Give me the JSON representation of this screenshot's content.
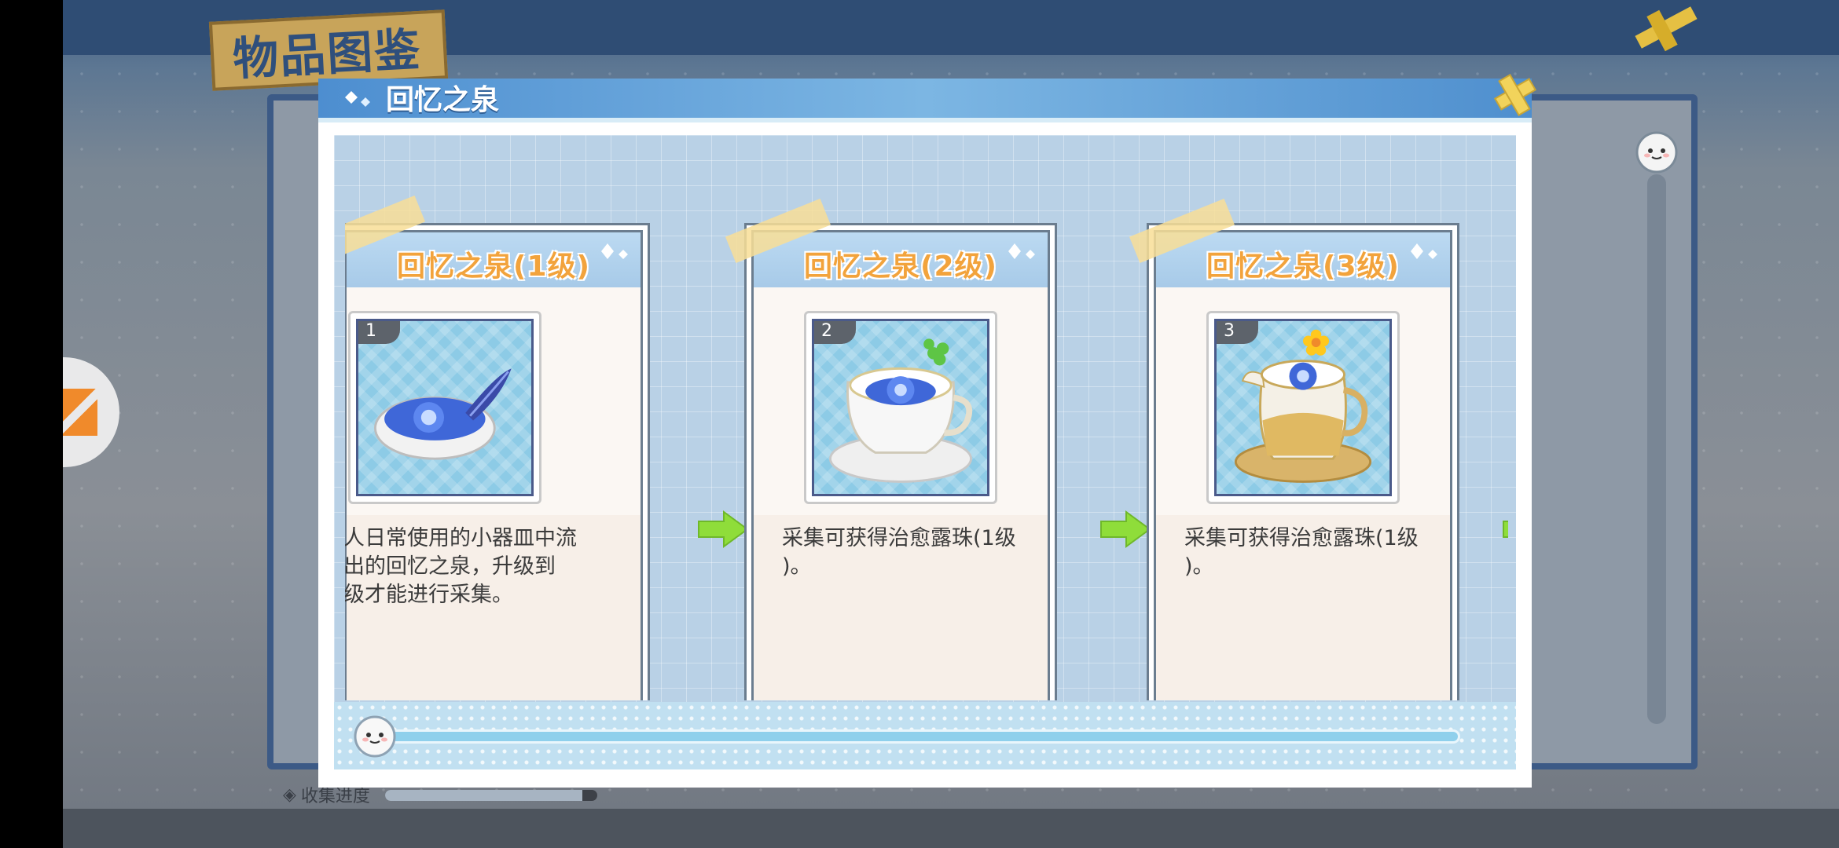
{
  "background": {
    "catalog_title": "物品图鉴",
    "progress_label": "收集进度",
    "progress": 0.93
  },
  "dialog": {
    "title": "回忆之泉",
    "cards": [
      {
        "name": "回忆之泉(1级)",
        "level": "1",
        "description_lines": [
          "人日常使用的小器皿中流",
          "出的回忆之泉，升级到",
          "级才能进行采集。"
        ],
        "art": "bowl-with-feather"
      },
      {
        "name": "回忆之泉(2级)",
        "level": "2",
        "description_lines": [
          "采集可获得治愈露珠(1级",
          ")。"
        ],
        "art": "teacup-with-clover"
      },
      {
        "name": "回忆之泉(3级)",
        "level": "3",
        "description_lines": [
          "采集可获得治愈露珠(1级",
          ")。"
        ],
        "art": "pitcher-with-flower"
      }
    ]
  },
  "colors": {
    "header_blue": "#5d9fd8",
    "card_title_orange": "#f2a33c",
    "arrow_green": "#8fdd3a"
  }
}
